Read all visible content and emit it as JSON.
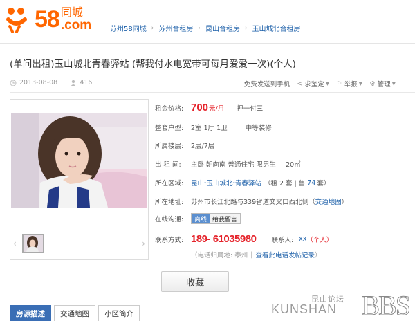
{
  "header": {
    "logo_number": "58",
    "logo_cn": "同城",
    "logo_com": ".com",
    "breadcrumb": [
      "苏州58同城",
      "苏州合租房",
      "昆山合租房",
      "玉山城北合租房"
    ]
  },
  "listing": {
    "title": "(单间出租)玉山城北青春驿站 (帮我付水电宽带可每月爱爱一次)(个人)",
    "date": "2013-08-08",
    "views": "416",
    "actions": [
      "免费发送到手机",
      "求鉴定",
      "举报",
      "管理"
    ]
  },
  "info": {
    "price_label": "租金价格:",
    "price": "700",
    "price_unit": "元/月",
    "payment": "押一付三",
    "layout_label": "整套户型:",
    "layout": "2室  1厅  1卫",
    "decoration": "中等装修",
    "floor_label": "所属楼层:",
    "floor": "2层/7层",
    "rent_label": "出 租 间:",
    "rent_detail": "主卧   朝向南   普通住宅   限男生",
    "area": "20㎡",
    "region_label": "所在区域:",
    "region_city": "昆山",
    "region_dash1": " - ",
    "region_district": "玉山城北",
    "region_dash2": " - ",
    "region_estate": "青春驿站",
    "region_count_pre": "（租 2 套  |  售",
    "region_count_num": "74",
    "region_count_post": "套）",
    "address_label": "所在地址:",
    "address": "苏州市长江北路与339省道交叉口西北侧",
    "map_open": "（",
    "map_link": "交通地图",
    "map_close": "）",
    "chat_label": "在线沟通:",
    "chat_status": "离线",
    "chat_msg": "给我留言",
    "contact_label": "联系方式:",
    "phone": "189- 61035980",
    "contact_person_label": "联系人:",
    "contact_person": "xx",
    "contact_tag": "（个人）",
    "phone_origin": "（电话归属地: 泰州",
    "phone_records": "查看此电话发帖记录",
    "phone_records_close": "）"
  },
  "save_button": "收藏",
  "tabs": [
    "房源描述",
    "交通地图",
    "小区简介"
  ],
  "watermark": {
    "cn": "昆山论坛",
    "en": "KUNSHAN",
    "bbs": "BBS"
  },
  "colors": {
    "brand": "#ff6600",
    "link": "#1a5ea8",
    "price": "#e5222a",
    "tab_active": "#3a6eb5"
  }
}
